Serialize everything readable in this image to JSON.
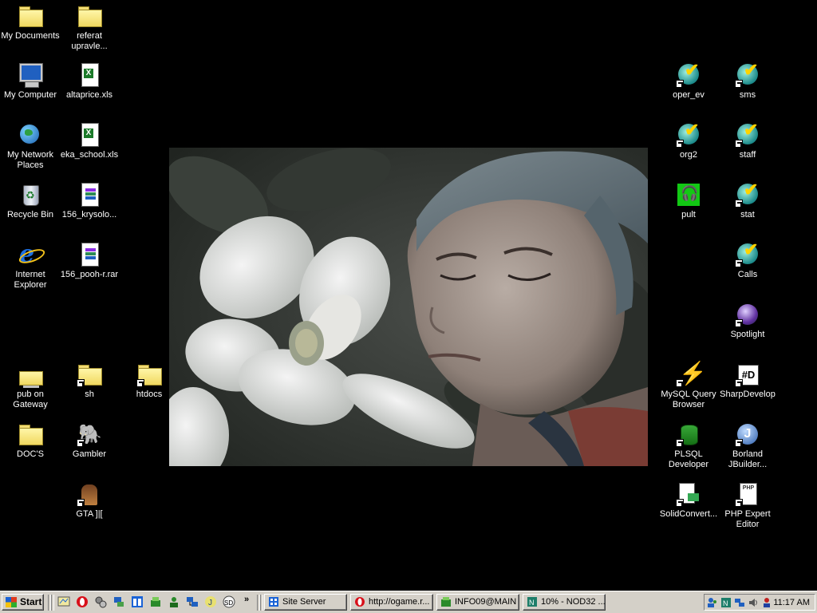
{
  "desktop": {
    "icons_left": [
      {
        "label": "My Documents"
      },
      {
        "label": "referat upravle..."
      },
      {
        "label": "My Computer"
      },
      {
        "label": "altaprice.xls"
      },
      {
        "label": "My Network Places"
      },
      {
        "label": "eka_school.xls"
      },
      {
        "label": "Recycle Bin"
      },
      {
        "label": "156_krysolo..."
      },
      {
        "label": "Internet Explorer"
      },
      {
        "label": "156_pooh-r.rar"
      },
      {
        "label": "pub on Gateway"
      },
      {
        "label": "sh"
      },
      {
        "label": "htdocs"
      },
      {
        "label": "DOC'S"
      },
      {
        "label": "Gambler"
      },
      {
        "label": "GTA ]|["
      }
    ],
    "icons_right": [
      {
        "label": "oper_ev"
      },
      {
        "label": "sms"
      },
      {
        "label": "org2"
      },
      {
        "label": "staff"
      },
      {
        "label": "pult"
      },
      {
        "label": "stat"
      },
      {
        "label": "Calls"
      },
      {
        "label": "Spotlight"
      },
      {
        "label": "MySQL Query Browser"
      },
      {
        "label": "SharpDevelop"
      },
      {
        "label": "PLSQL Developer"
      },
      {
        "label": "Borland JBuilder..."
      },
      {
        "label": "SolidConvert..."
      },
      {
        "label": "PHP Expert Editor"
      }
    ]
  },
  "taskbar": {
    "start_label": "Start",
    "chevron": "»",
    "tasks": [
      {
        "label": "Site Server"
      },
      {
        "label": "http://ogame.r..."
      },
      {
        "label": "INFO09@MAIN"
      },
      {
        "label": "10% - NOD32 ..."
      }
    ],
    "clock": "11:17 AM"
  },
  "colors": {
    "desktop_bg": "#000000",
    "taskbar_bg": "#d4d0c8",
    "icon_label": "#ffffff"
  }
}
